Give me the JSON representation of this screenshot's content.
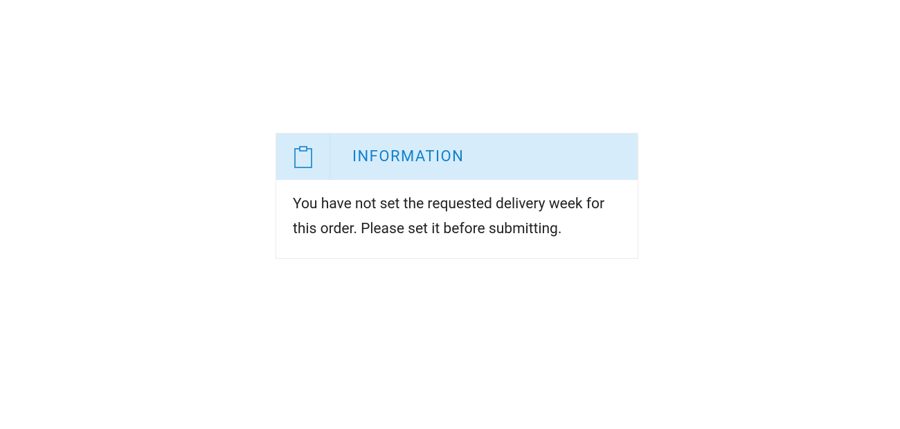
{
  "info": {
    "title": "INFORMATION",
    "message": "You have not set the requested delivery week for this order. Please set it before submitting.",
    "icon_name": "clipboard-icon",
    "accent_color": "#1182cc",
    "header_bg": "#d6ecfa"
  }
}
